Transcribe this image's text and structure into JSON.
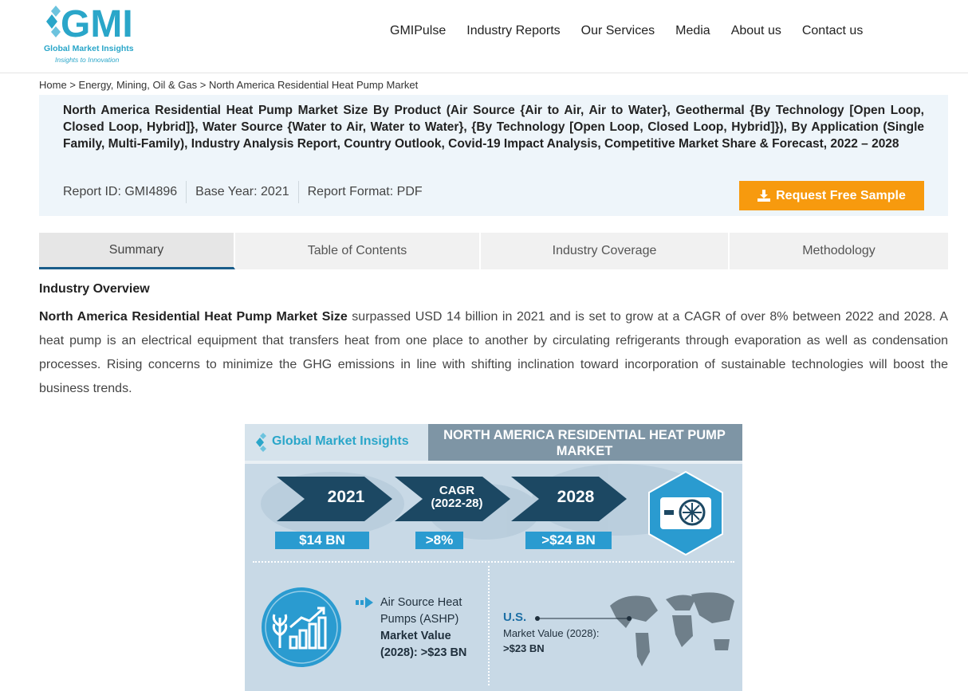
{
  "header": {
    "logo": {
      "mark": "GMI",
      "name": "Global Market Insights",
      "tagline": "Insights to Innovation"
    },
    "nav": [
      "GMIPulse",
      "Industry Reports",
      "Our Services",
      "Media",
      "About us",
      "Contact us"
    ]
  },
  "breadcrumb": {
    "items": [
      "Home",
      "Energy, Mining, Oil & Gas",
      "North America Residential Heat Pump Market"
    ],
    "separator": ">"
  },
  "report": {
    "title": "North America Residential Heat Pump Market Size By Product (Air Source {Air to Air, Air to Water}, Geothermal {By Technology [Open Loop, Closed Loop, Hybrid]}, Water Source {Water to Air, Water to Water}, {By Technology [Open Loop, Closed Loop, Hybrid]}), By Application (Single Family, Multi-Family), Industry Analysis Report, Country Outlook, Covid-19 Impact Analysis, Competitive Market Share & Forecast, 2022 – 2028",
    "report_id": "Report ID: GMI4896",
    "base_year": "Base Year: 2021",
    "format": "Report Format: PDF",
    "sample_button": "Request Free Sample"
  },
  "tabs": [
    {
      "label": "Summary",
      "active": true
    },
    {
      "label": "Table of Contents",
      "active": false
    },
    {
      "label": "Industry Coverage",
      "active": false
    },
    {
      "label": "Methodology",
      "active": false
    }
  ],
  "overview": {
    "heading": "Industry Overview",
    "lead_bold": "North America Residential Heat Pump Market Size",
    "body": " surpassed USD 14 billion in 2021 and is set to grow at a CAGR of over 8% between 2022 and 2028. A heat pump is an electrical equipment that transfers heat from one place to another by circulating refrigerants through evaporation as well as condensation processes. Rising concerns to minimize the GHG emissions in line with shifting inclination toward incorporation of sustainable technologies will boost the business trends."
  },
  "infographic": {
    "logo_text": "Global Market Insights",
    "title": "NORTH AMERICA RESIDENTIAL HEAT PUMP MARKET",
    "stats": [
      {
        "label": "2021",
        "value": "$14 BN"
      },
      {
        "label": "CAGR",
        "sublabel": "(2022-28)",
        "value": ">8%"
      },
      {
        "label": "2028",
        "value": ">$24 BN"
      }
    ],
    "ashp": {
      "line1": "Air Source Heat",
      "line2": "Pumps (ASHP)",
      "line3": "Market Value",
      "line4": "(2028): >$23 BN"
    },
    "us": {
      "label": "U.S.",
      "line1": "Market Value (2028):",
      "line2": ">$23 BN"
    },
    "colors": {
      "accent": "#2a9bd0",
      "chevron": "#1c4863",
      "banner": "#7e95a5"
    }
  },
  "colors": {
    "brand": "#2aa6c9",
    "button": "#f79a0e",
    "tab_active_border": "#1a5d8a",
    "title_bg": "#eef5fa"
  }
}
